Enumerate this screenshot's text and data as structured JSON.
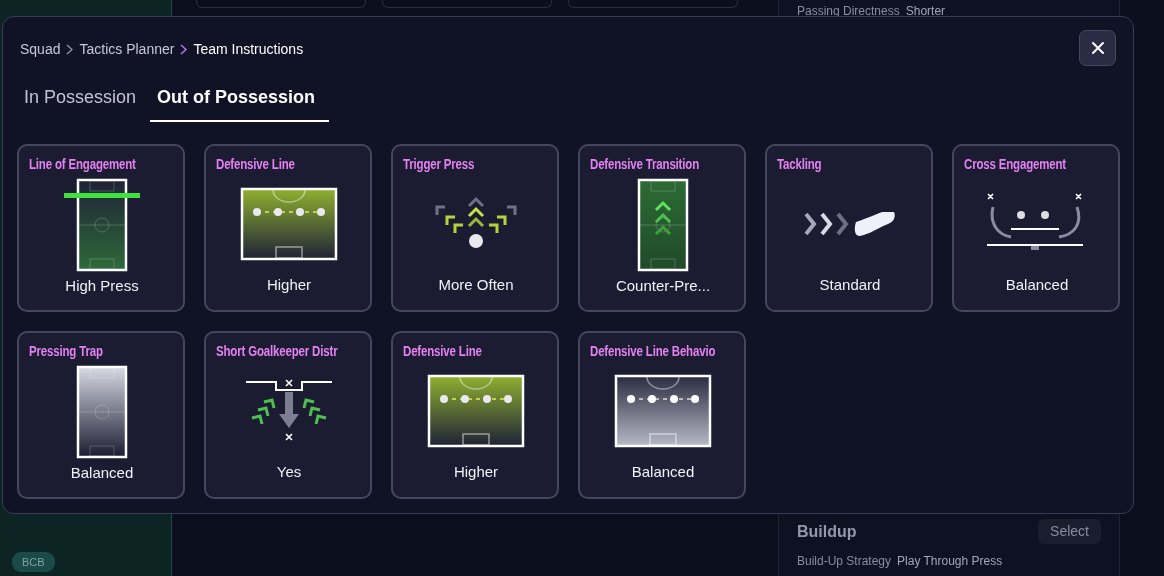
{
  "background": {
    "left_panel": {
      "position_badge": "BCB"
    },
    "right_panel": {
      "passing_directness": {
        "label": "Passing Directness",
        "value": "Shorter"
      },
      "section_title": "Buildup",
      "select_button": "Select",
      "build_up_strategy": {
        "label": "Build-Up Strategy",
        "value": "Play Through Press"
      }
    }
  },
  "modal": {
    "breadcrumb": [
      {
        "label": "Squad",
        "current": false
      },
      {
        "label": "Tactics Planner",
        "current": false
      },
      {
        "label": "Team Instructions",
        "current": true
      }
    ],
    "tabs": [
      {
        "label": "In Possession",
        "selected": false
      },
      {
        "label": "Out of Possession",
        "selected": true
      }
    ],
    "cards": [
      {
        "title": "Line of Engagement",
        "value": "High Press",
        "kind": "engagement"
      },
      {
        "title": "Defensive Line",
        "value": "Higher",
        "kind": "line-green"
      },
      {
        "title": "Trigger Press",
        "value": "More Often",
        "kind": "press"
      },
      {
        "title": "Defensive Transition",
        "value": "Counter-Pre...",
        "kind": "transition"
      },
      {
        "title": "Tackling",
        "value": "Standard",
        "kind": "tackle"
      },
      {
        "title": "Cross Engagement",
        "value": "Balanced",
        "kind": "cross"
      },
      {
        "title": "Pressing Trap",
        "value": "Balanced",
        "kind": "trap"
      },
      {
        "title": "Short Goalkeeper Distr",
        "value": "Yes",
        "kind": "goalkeeper"
      },
      {
        "title": "Defensive Line",
        "value": "Higher",
        "kind": "line-green"
      },
      {
        "title": "Defensive Line Behavio",
        "value": "Balanced",
        "kind": "line-grey"
      }
    ]
  }
}
